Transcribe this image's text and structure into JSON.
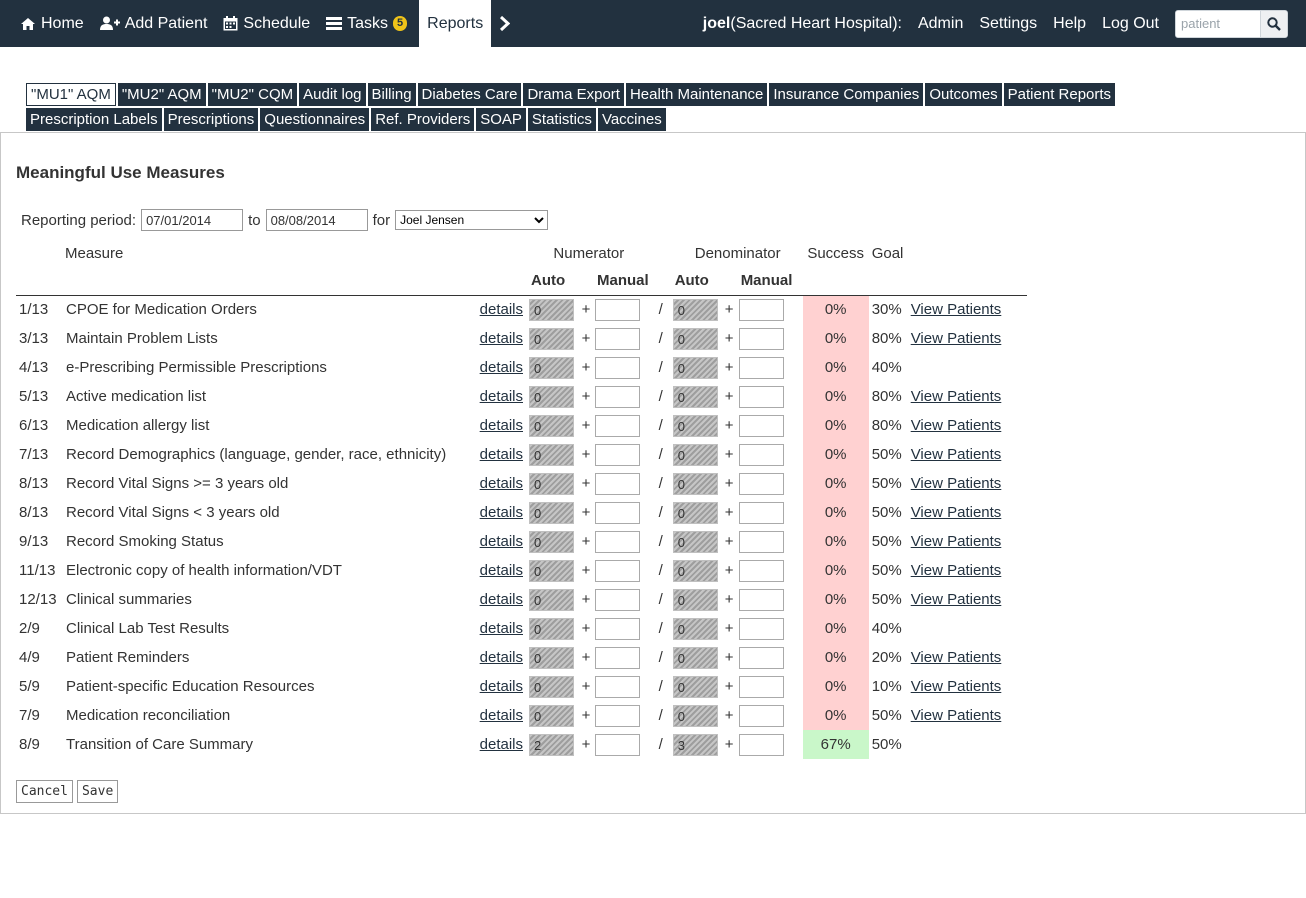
{
  "nav": {
    "items": [
      {
        "name": "nav-home",
        "icon": "home-icon",
        "label": "Home"
      },
      {
        "name": "nav-add-patient",
        "icon": "add-user-icon",
        "label": "Add Patient"
      },
      {
        "name": "nav-schedule",
        "icon": "calendar-icon",
        "label": "Schedule"
      },
      {
        "name": "nav-tasks",
        "icon": "list-icon",
        "label": "Tasks",
        "badge": "5"
      },
      {
        "name": "nav-reports",
        "icon": "",
        "label": "Reports",
        "active": true
      }
    ],
    "more_icon": "chevron-right-icon",
    "user_name": "joel",
    "user_context": "(Sacred Heart Hospital):",
    "links": [
      "Admin",
      "Settings",
      "Help",
      "Log Out"
    ],
    "search_placeholder": "patient",
    "search_icon": "search-icon"
  },
  "tabs": {
    "row1": [
      "\"MU1\" AQM",
      "\"MU2\" AQM",
      "\"MU2\" CQM",
      "Audit log",
      "Billing",
      "Diabetes Care",
      "Drama Export",
      "Health Maintenance",
      "Insurance Companies",
      "Outcomes",
      "Patient Reports"
    ],
    "row2": [
      "Prescription Labels",
      "Prescriptions",
      "Questionnaires",
      "Ref. Providers",
      "SOAP",
      "Statistics",
      "Vaccines"
    ],
    "active": "\"MU1\" AQM"
  },
  "page": {
    "title": "Meaningful Use Measures",
    "period_label": "Reporting period:",
    "from": "07/01/2014",
    "to_label": "to",
    "to": "08/08/2014",
    "for_label": "for",
    "provider": "Joel Jensen"
  },
  "table": {
    "headers": {
      "measure": "Measure",
      "numerator": "Numerator",
      "denominator": "Denominator",
      "success": "Success",
      "goal": "Goal",
      "auto": "Auto",
      "manual": "Manual"
    },
    "details_label": "details",
    "view_label": "View Patients",
    "plus": "+",
    "slash": "/",
    "rows": [
      {
        "num": "1/13",
        "measure": "CPOE for Medication Orders",
        "n_auto": "0",
        "d_auto": "0",
        "success": "0%",
        "goal": "30%",
        "view": true
      },
      {
        "num": "3/13",
        "measure": "Maintain Problem Lists",
        "n_auto": "0",
        "d_auto": "0",
        "success": "0%",
        "goal": "80%",
        "view": true
      },
      {
        "num": "4/13",
        "measure": "e-Prescribing Permissible Prescriptions",
        "n_auto": "0",
        "d_auto": "0",
        "success": "0%",
        "goal": "40%",
        "view": false
      },
      {
        "num": "5/13",
        "measure": "Active medication list",
        "n_auto": "0",
        "d_auto": "0",
        "success": "0%",
        "goal": "80%",
        "view": true
      },
      {
        "num": "6/13",
        "measure": "Medication allergy list",
        "n_auto": "0",
        "d_auto": "0",
        "success": "0%",
        "goal": "80%",
        "view": true
      },
      {
        "num": "7/13",
        "measure": "Record Demographics (language, gender, race, ethnicity)",
        "n_auto": "0",
        "d_auto": "0",
        "success": "0%",
        "goal": "50%",
        "view": true
      },
      {
        "num": "8/13",
        "measure": "Record Vital Signs >= 3 years old",
        "n_auto": "0",
        "d_auto": "0",
        "success": "0%",
        "goal": "50%",
        "view": true
      },
      {
        "num": "8/13",
        "measure": "Record Vital Signs < 3 years old",
        "n_auto": "0",
        "d_auto": "0",
        "success": "0%",
        "goal": "50%",
        "view": true
      },
      {
        "num": "9/13",
        "measure": "Record Smoking Status",
        "n_auto": "0",
        "d_auto": "0",
        "success": "0%",
        "goal": "50%",
        "view": true
      },
      {
        "num": "11/13",
        "measure": "Electronic copy of health information/VDT",
        "n_auto": "0",
        "d_auto": "0",
        "success": "0%",
        "goal": "50%",
        "view": true
      },
      {
        "num": "12/13",
        "measure": "Clinical summaries",
        "n_auto": "0",
        "d_auto": "0",
        "success": "0%",
        "goal": "50%",
        "view": true
      },
      {
        "num": "2/9",
        "measure": "Clinical Lab Test Results",
        "n_auto": "0",
        "d_auto": "0",
        "success": "0%",
        "goal": "40%",
        "view": false
      },
      {
        "num": "4/9",
        "measure": "Patient Reminders",
        "n_auto": "0",
        "d_auto": "0",
        "success": "0%",
        "goal": "20%",
        "view": true
      },
      {
        "num": "5/9",
        "measure": "Patient-specific Education Resources",
        "n_auto": "0",
        "d_auto": "0",
        "success": "0%",
        "goal": "10%",
        "view": true
      },
      {
        "num": "7/9",
        "measure": "Medication reconciliation",
        "n_auto": "0",
        "d_auto": "0",
        "success": "0%",
        "goal": "50%",
        "view": true
      },
      {
        "num": "8/9",
        "measure": "Transition of Care Summary",
        "n_auto": "2",
        "d_auto": "3",
        "success": "67%",
        "goal": "50%",
        "view": false
      }
    ]
  },
  "buttons": {
    "cancel": "Cancel",
    "save": "Save"
  },
  "colors": {
    "nav_bg": "#22313f",
    "success_fail": "#ffd1d1",
    "success_pass": "#c9f7c9"
  }
}
